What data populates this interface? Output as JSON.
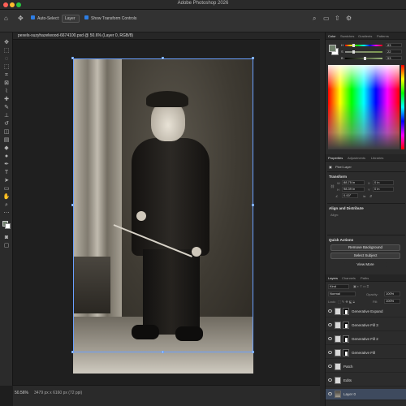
{
  "app": {
    "title": "Adobe Photoshop 2026"
  },
  "options_bar": {
    "auto_select_label": "Auto-Select:",
    "auto_select_value": "Layer",
    "show_transform_label": "Show Transform Controls"
  },
  "document": {
    "tab_label": "pexels-suzyhazelwood-6674100.psd @ 50.6% (Layer 0, RGB/8)"
  },
  "status": {
    "zoom": "50.56%",
    "info": "3479 px x 6160 px (72 ppi)"
  },
  "color_panel": {
    "tabs": [
      "Color",
      "Swatches",
      "Gradients",
      "Patterns"
    ],
    "sliders": [
      {
        "label": "H",
        "value": "83",
        "level": 0.23
      },
      {
        "label": "S",
        "value": "22",
        "level": 0.22
      },
      {
        "label": "B",
        "value": "53",
        "level": 0.53
      }
    ],
    "colors": {
      "foreground": "#6f7f6b",
      "background": "#ffffff"
    }
  },
  "properties_panel": {
    "tabs": [
      "Properties",
      "Adjustments",
      "Libraries"
    ],
    "type_label": "Pixel Layer",
    "transform_head": "Transform",
    "w_value": "88.75 in",
    "h_value": "98.39 in",
    "x_value": "0 in",
    "y_value": "0 in",
    "angle_value": "0.00°",
    "align_head": "Align and Distribute",
    "align_label": "Align:",
    "quick_head": "Quick Actions",
    "remove_bg": "Remove Background",
    "select_subject": "Select Subject",
    "view_more": "View More"
  },
  "layers_panel": {
    "tabs": [
      "Layers",
      "Channels",
      "Paths"
    ],
    "kind_label": "Kind",
    "blend_mode": "Normal",
    "opacity_label": "Opacity:",
    "opacity_value": "100%",
    "lock_label": "Lock:",
    "fill_label": "Fill:",
    "fill_value": "100%",
    "layers": [
      {
        "name": "Generative Expand",
        "mask": true,
        "selected": false
      },
      {
        "name": "Generative Fill 3",
        "mask": true,
        "selected": false
      },
      {
        "name": "Generative Fill 2",
        "mask": true,
        "selected": false
      },
      {
        "name": "Generative Fill",
        "mask": true,
        "selected": false
      },
      {
        "name": "Patch",
        "mask": false,
        "selected": false
      },
      {
        "name": "Edits",
        "mask": false,
        "selected": false
      },
      {
        "name": "Layer 0",
        "mask": false,
        "selected": true
      }
    ]
  }
}
